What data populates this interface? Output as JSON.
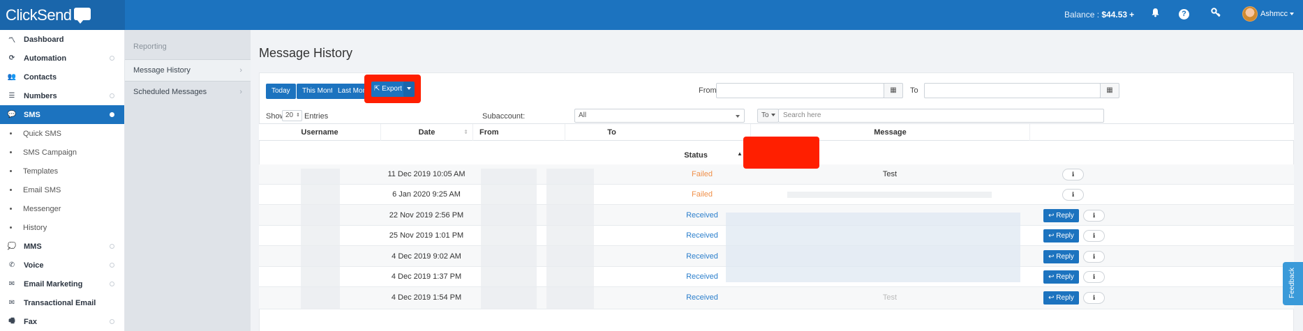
{
  "topbar": {
    "logo": "ClickSend",
    "balance_label": "Balance : ",
    "balance_value": "$44.53",
    "balance_plus": "+",
    "username": "Ashmcc"
  },
  "sidebar": {
    "items": [
      {
        "label": "Dashboard",
        "icon": "chart-icon"
      },
      {
        "label": "Automation",
        "icon": "refresh-icon"
      },
      {
        "label": "Contacts",
        "icon": "users-icon"
      },
      {
        "label": "Numbers",
        "icon": "database-icon"
      },
      {
        "label": "SMS",
        "icon": "comment-icon"
      },
      {
        "label": "MMS",
        "icon": "comment-icon"
      },
      {
        "label": "Voice",
        "icon": "phone-icon"
      },
      {
        "label": "Email Marketing",
        "icon": "envelope-icon"
      },
      {
        "label": "Transactional Email",
        "icon": "envelope-icon"
      },
      {
        "label": "Fax",
        "icon": "fax-icon"
      }
    ],
    "sms_sub": [
      "Quick SMS",
      "SMS Campaign",
      "Templates",
      "Email SMS",
      "Messenger",
      "History"
    ]
  },
  "subnav": {
    "heading": "Reporting",
    "items": [
      "Message History",
      "Scheduled Messages"
    ]
  },
  "page": {
    "title": "Message History",
    "buttons": {
      "today": "Today",
      "this_month": "This Month",
      "last_month": "Last Month",
      "export": "Export"
    },
    "from_label": "From",
    "to_label": "To",
    "show_label": "Show",
    "show_value": "20",
    "entries_label": "Entries",
    "subaccount_label": "Subaccount:",
    "subaccount_value": "All",
    "search_field": "To",
    "search_placeholder": "Search here"
  },
  "table": {
    "headers": [
      "Username",
      "Date",
      "From",
      "To",
      "Status",
      "Message"
    ],
    "reply_label": "Reply",
    "rows": [
      {
        "date": "11 Dec 2019 10:05 AM",
        "status": "Failed",
        "message": "Test",
        "reply": false
      },
      {
        "date": "6 Jan 2020 9:25 AM",
        "status": "Failed",
        "message": "",
        "reply": false
      },
      {
        "date": "22 Nov 2019 2:56 PM",
        "status": "Received",
        "message": "",
        "reply": true
      },
      {
        "date": "25 Nov 2019 1:01 PM",
        "status": "Received",
        "message": "",
        "reply": true
      },
      {
        "date": "4 Dec 2019 9:02 AM",
        "status": "Received",
        "message": "",
        "reply": true
      },
      {
        "date": "4 Dec 2019 1:37 PM",
        "status": "Received",
        "message": "",
        "reply": true
      },
      {
        "date": "4 Dec 2019 1:54 PM",
        "status": "Received",
        "message": "Test",
        "reply": true
      }
    ]
  },
  "feedback_label": "Feedback",
  "colors": {
    "primary": "#1c73bf",
    "highlight": "#ff1f00",
    "failed": "#f0904a",
    "received": "#2c7fcc"
  }
}
